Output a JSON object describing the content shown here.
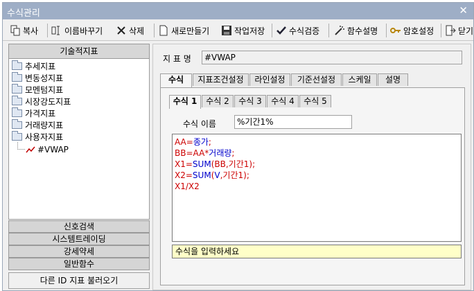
{
  "window": {
    "title": "수식관리"
  },
  "toolbar": {
    "items": [
      {
        "label": "복사",
        "icon": "copy-icon"
      },
      {
        "label": "이름바꾸기",
        "icon": "rename-icon"
      },
      {
        "label": "삭제",
        "icon": "delete-x-icon"
      },
      {
        "label": "새로만들기",
        "icon": "new-document-icon"
      },
      {
        "label": "작업저장",
        "icon": "save-disk-icon"
      },
      {
        "label": "수식검증",
        "icon": "check-icon"
      },
      {
        "label": "함수설명",
        "icon": "magic-wand-icon"
      },
      {
        "label": "암호설정",
        "icon": "key-icon"
      },
      {
        "label": "닫기",
        "icon": "exit-door-icon"
      }
    ]
  },
  "sidebar": {
    "header": "기술적지표",
    "tree": [
      {
        "label": "추세지표"
      },
      {
        "label": "변동성지표"
      },
      {
        "label": "모멘텀지표"
      },
      {
        "label": "시장강도지표"
      },
      {
        "label": "가격지표"
      },
      {
        "label": "거래량지표"
      },
      {
        "label": "사용자지표"
      }
    ],
    "leaf": {
      "label": "#VWAP"
    },
    "buttons": [
      "신호검색",
      "시스템트레이딩",
      "강세약세",
      "일반함수"
    ],
    "load_button": "다른 ID 지표 불러오기"
  },
  "main": {
    "indicator_label": "지 표 명",
    "indicator_value": "#VWAP",
    "tabs": [
      "수식",
      "지표조건설정",
      "라인설정",
      "기준선설정",
      "스케일",
      "설명"
    ],
    "subtabs": [
      "수식 1",
      "수식 2",
      "수식 3",
      "수식 4",
      "수식 5"
    ],
    "formula_name_label": "수식 이름",
    "formula_name_value": "%기간1%",
    "formula_lines": [
      [
        {
          "t": "AA",
          "c": "red"
        },
        {
          "t": "=",
          "c": "red"
        },
        {
          "t": "종가",
          "c": "blue"
        },
        {
          "t": ";",
          "c": "red"
        }
      ],
      [
        {
          "t": "BB",
          "c": "red"
        },
        {
          "t": "=",
          "c": "red"
        },
        {
          "t": "AA",
          "c": "red"
        },
        {
          "t": "*",
          "c": "red"
        },
        {
          "t": "거래량",
          "c": "blue"
        },
        {
          "t": ";",
          "c": "red"
        }
      ],
      [
        {
          "t": "X1",
          "c": "red"
        },
        {
          "t": "=",
          "c": "red"
        },
        {
          "t": "SUM",
          "c": "blue"
        },
        {
          "t": "(",
          "c": "red"
        },
        {
          "t": "BB",
          "c": "red"
        },
        {
          "t": ",",
          "c": "red"
        },
        {
          "t": "기간1",
          "c": "red"
        },
        {
          "t": ");",
          "c": "red"
        }
      ],
      [
        {
          "t": "X2",
          "c": "red"
        },
        {
          "t": "=",
          "c": "red"
        },
        {
          "t": "SUM",
          "c": "blue"
        },
        {
          "t": "(",
          "c": "red"
        },
        {
          "t": "V",
          "c": "blue"
        },
        {
          "t": ",",
          "c": "red"
        },
        {
          "t": "기간1",
          "c": "red"
        },
        {
          "t": ");",
          "c": "red"
        }
      ],
      [
        {
          "t": "X1",
          "c": "red"
        },
        {
          "t": "/",
          "c": "red"
        },
        {
          "t": "X2",
          "c": "red"
        }
      ]
    ],
    "hint": "수식을 입력하세요"
  }
}
